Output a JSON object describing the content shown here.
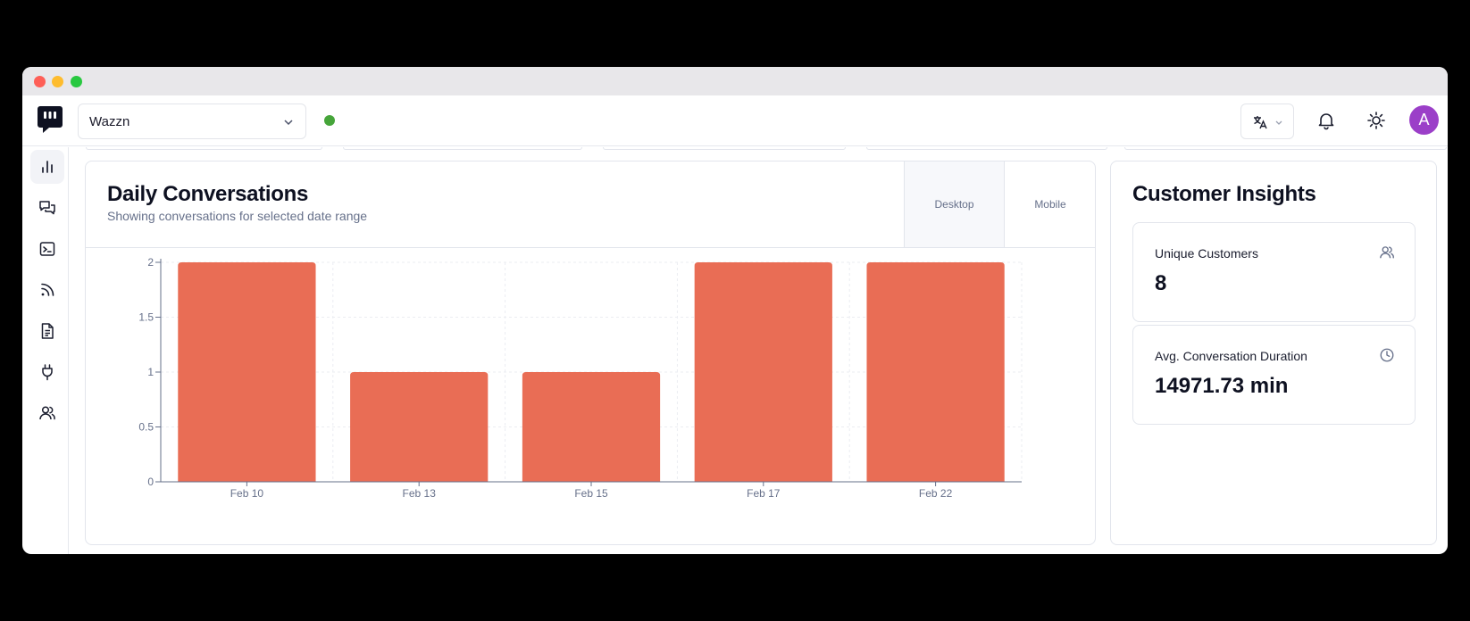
{
  "window": {
    "controls": [
      "close",
      "minimize",
      "maximize"
    ]
  },
  "topbar": {
    "workspace": "Wazzn",
    "status_color": "#46a53a",
    "avatar_initial": "A",
    "avatar_color": "#9b3fc8",
    "icons": [
      "translate-icon",
      "bell-icon",
      "sun-icon"
    ]
  },
  "sidebar": {
    "items": [
      {
        "name": "analytics",
        "icon": "bar-chart-icon",
        "active": true
      },
      {
        "name": "conversations",
        "icon": "chat-icon",
        "active": false
      },
      {
        "name": "terminal",
        "icon": "terminal-icon",
        "active": false
      },
      {
        "name": "feeds",
        "icon": "rss-icon",
        "active": false
      },
      {
        "name": "documents",
        "icon": "document-icon",
        "active": false
      },
      {
        "name": "integrations",
        "icon": "plug-icon",
        "active": false
      },
      {
        "name": "users",
        "icon": "users-icon",
        "active": false
      }
    ]
  },
  "chart_card": {
    "title": "Daily Conversations",
    "subtitle": "Showing conversations for selected date range",
    "tabs": {
      "desktop": "Desktop",
      "mobile": "Mobile"
    },
    "active_tab": "Desktop"
  },
  "chart_data": {
    "type": "bar",
    "categories": [
      "Feb 10",
      "Feb 13",
      "Feb 15",
      "Feb 17",
      "Feb 22"
    ],
    "values": [
      2,
      1,
      1,
      2,
      2
    ],
    "ylim": [
      0,
      2
    ],
    "yticks": [
      0,
      0.5,
      1,
      1.5,
      2
    ],
    "ytick_labels": [
      "0",
      "0.5",
      "1",
      "1.5",
      "2"
    ],
    "grid": true,
    "bar_color": "#e96d55",
    "title": "",
    "xlabel": "",
    "ylabel": ""
  },
  "insights": {
    "title": "Customer Insights",
    "metrics": [
      {
        "label": "Unique Customers",
        "value": "8",
        "icon": "users-icon"
      },
      {
        "label": "Avg. Conversation Duration",
        "value": "14971.73 min",
        "icon": "clock-icon"
      }
    ]
  }
}
